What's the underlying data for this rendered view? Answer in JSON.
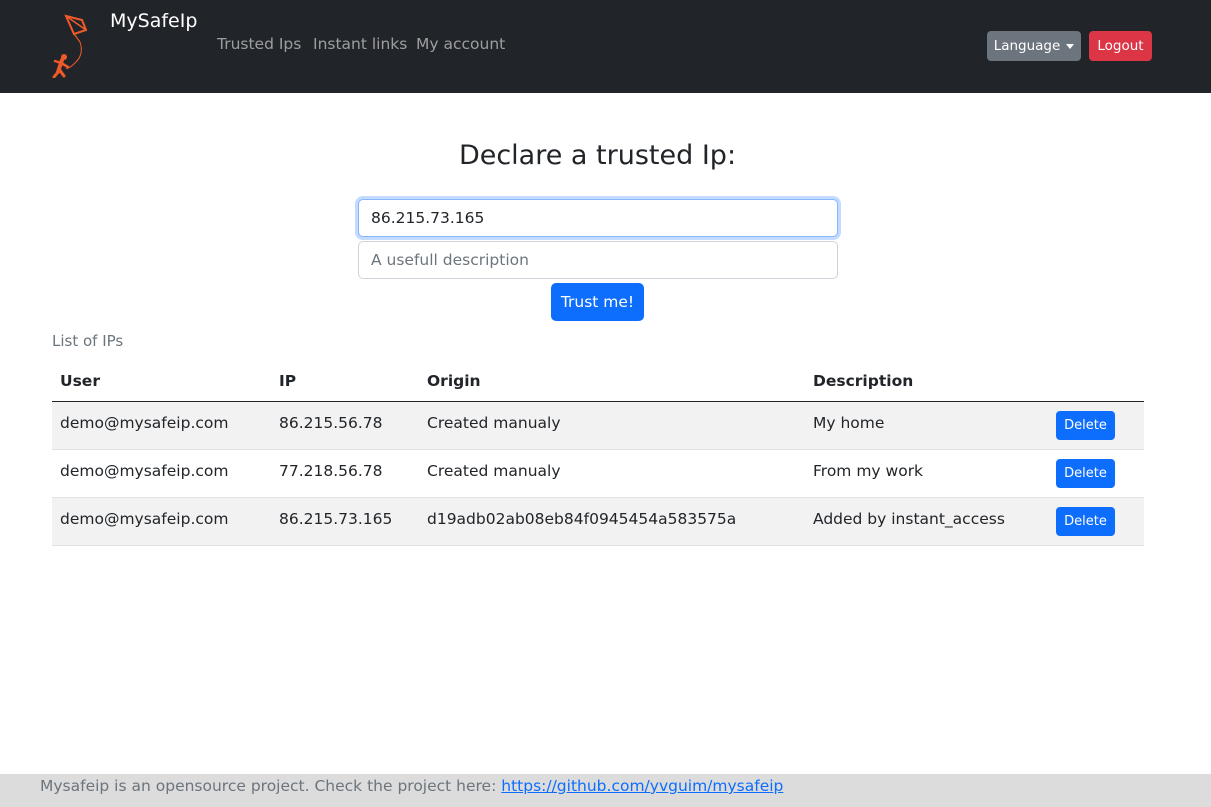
{
  "navbar": {
    "brand": "MySafeIp",
    "links": [
      "Trusted Ips",
      "Instant links",
      "My account"
    ],
    "language_label": "Language",
    "logout_label": "Logout"
  },
  "form": {
    "title": "Declare a trusted Ip:",
    "ip_value": "86.215.73.165",
    "description_placeholder": "A usefull description",
    "submit_label": "Trust me!"
  },
  "list": {
    "caption": "List of IPs",
    "columns": [
      "User",
      "IP",
      "Origin",
      "Description"
    ],
    "rows": [
      {
        "user": "demo@mysafeip.com",
        "ip": "86.215.56.78",
        "origin": "Created manualy",
        "description": "My home",
        "action": "Delete"
      },
      {
        "user": "demo@mysafeip.com",
        "ip": "77.218.56.78",
        "origin": "Created manualy",
        "description": "From my work",
        "action": "Delete"
      },
      {
        "user": "demo@mysafeip.com",
        "ip": "86.215.73.165",
        "origin": "d19adb02ab08eb84f0945454a583575a",
        "description": "Added by instant_access",
        "action": "Delete"
      }
    ]
  },
  "footer": {
    "text": "Mysafeip is an opensource project. Check the project here: ",
    "link_text": "https://github.com/yvguim/mysafeip"
  },
  "icons": {
    "logo": "kite-logo-icon",
    "language_caret": "caret-down-icon"
  },
  "colors": {
    "navbar_bg": "#212529",
    "primary": "#0d6efd",
    "danger": "#dc3545",
    "secondary": "#6c757d",
    "logo_orange": "#f05a28"
  }
}
